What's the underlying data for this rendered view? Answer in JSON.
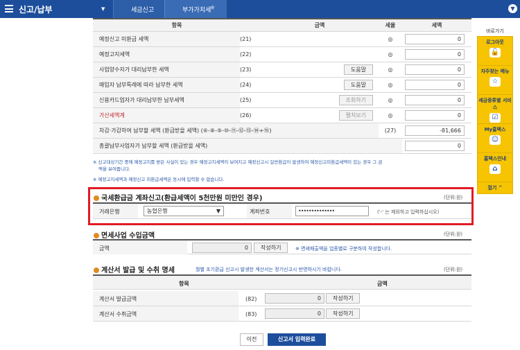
{
  "topbar": {
    "title": "신고/납부",
    "dropdown": "▼",
    "crumb1": "세금신고",
    "crumb2": "부가가치세",
    "star": "★",
    "collapse": "▼"
  },
  "table": {
    "headers": [
      "항목",
      "금액",
      "세율",
      "세액"
    ],
    "rows": [
      {
        "label": "예정신고 미환급 세액",
        "code": "(21)",
        "rate": "◎",
        "value": "0",
        "button": ""
      },
      {
        "label": "예정고지세액",
        "code": "(22)",
        "rate": "◎",
        "value": "0",
        "button": ""
      },
      {
        "label": "사업양수자가 대리납부한 세액",
        "code": "(23)",
        "rate": "◎",
        "value": "0",
        "button": "도움말"
      },
      {
        "label": "매입자 납부특례에 따라 납부한 세액",
        "code": "(24)",
        "rate": "◎",
        "value": "0",
        "button": "도움말"
      },
      {
        "label": "신용카드업자가 대리납부한 납부세액",
        "code": "(25)",
        "rate": "◎",
        "value": "0",
        "button": "조회하기"
      },
      {
        "label": "가산세액계",
        "code": "(26)",
        "rate": "◎",
        "value": "0",
        "button": "펼쳐보기"
      }
    ],
    "total_label": "차감·가감하여 납부할 세액 (환급받을 세액) (⑥-⑧-⑨-⑩-⑪-⑫-⑬-⑭+⑮)",
    "total_code": "(27)",
    "total_value": "-81,666",
    "summary_label": "총괄납부사업자가 납부할 세액 (환급받을 세액)",
    "summary_value": "0"
  },
  "notes": {
    "n1": "※ 신고대상기간 중에 예정고지를 받은 사실이 있는 경우 예정고지세액이 보여지고 예정신고시 일반환급이 발생하여 예정신고미환급세액이 있는 경우 그 금",
    "n1b": "액을 보여줍니다.",
    "n2": "※ 예정고지세액과 예정신고 미환급세액은 동시에 입력할 수 없습니다."
  },
  "refund": {
    "title": "국세환급금 계좌신고(환급세액이 5천만원 미만인 경우)",
    "unit": "(단위:원)",
    "bank_label": "거래은행",
    "bank_value": "농협은행",
    "account_label": "계좌번호",
    "account_value": "••••••••••••••",
    "hint": "('-' 는 제외하고 입력하십시오)"
  },
  "exempt": {
    "title": "면세사업 수입금액",
    "unit": "(단위:원)",
    "label": "금액",
    "value": "0",
    "button": "작성하기",
    "note": "※ 면세매출액을 업종별로 구분하여 작성합니다."
  },
  "invoice": {
    "title": "계산서 발급 및 수취 명세",
    "note": "월별 조기환급 신고시 발생한 계산서는 정기신고시 반영하시기 바랍니다.",
    "unit": "(단위:원)",
    "h1": "항목",
    "h2": "금액",
    "rows": [
      {
        "label": "계산서 발급금액",
        "code": "(82)",
        "value": "0",
        "button": "작성하기"
      },
      {
        "label": "계산서 수취금액",
        "code": "(83)",
        "value": "0",
        "button": "작성하기"
      }
    ]
  },
  "buttons": {
    "prev": "이전",
    "save": "신고서 입력완료"
  },
  "quick": {
    "title": "바로가기",
    "items": [
      {
        "label": "로그아웃",
        "icon": "🔓"
      },
      {
        "label": "자주찾는 메뉴",
        "icon": "☆"
      },
      {
        "label": "세금종류별 서비스",
        "icon": "☑"
      },
      {
        "label": "My홈택스",
        "icon": "☺"
      },
      {
        "label": "홈택스인내",
        "icon": "⌂"
      }
    ],
    "close": "접기 ^"
  },
  "colors": {
    "brand": "#1d4e9c",
    "highlight": "#e01b24",
    "quick": "#f6c400"
  }
}
